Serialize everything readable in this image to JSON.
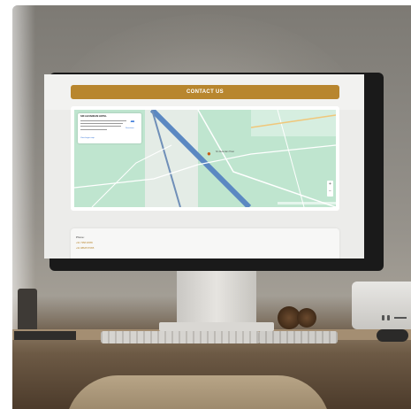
{
  "page": {
    "contact_title": "CONTACT US"
  },
  "map": {
    "place_name": "SRI ALIVANDAM HOTEL",
    "directions_label": "Directions",
    "view_larger": "View larger map",
    "pin_label": "Sri Alivandam Hotel",
    "zoom_in": "+",
    "zoom_out": "−",
    "road_color": "#5b88c2",
    "water_color": "#a9dcc6"
  },
  "contact": {
    "phone_label": "Phone:",
    "phones": [
      "+91 7358 24565",
      "+91 98625 87455"
    ]
  },
  "colors": {
    "accent": "#b8862e",
    "bar_text": "#ffffff"
  }
}
